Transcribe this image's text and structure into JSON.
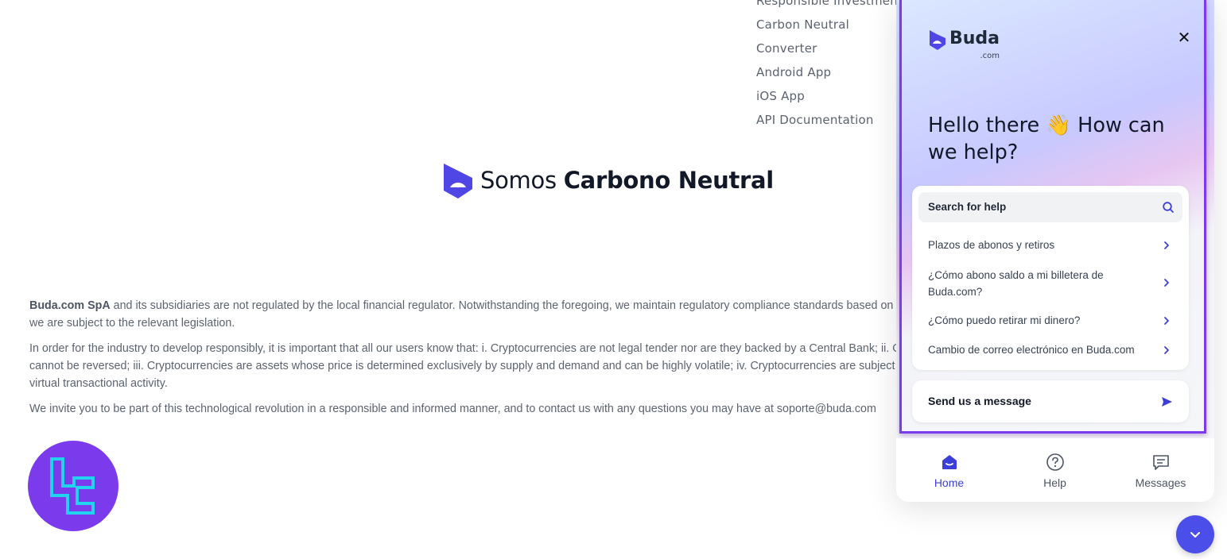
{
  "footer": {
    "links": [
      "Responsible Investment",
      "Carbon Neutral",
      "Converter",
      "Android App",
      "iOS App",
      "API Documentation"
    ]
  },
  "carbon_badge": {
    "prefix": "Somos",
    "bold": "Carbono Neutral"
  },
  "disclaimer": {
    "p1_bold": "Buda.com SpA",
    "p1_line1": " and its subsidiaries are not regulated by the local financial regulator. Notwithstanding the foregoing, we maintain regulatory compliance standards based on the regu",
    "p1_line2": "we are subject to the relevant legislation.",
    "p2_line1": "In order for the industry to develop responsibly, it is important that all our users know that: i. Cryptocurrencies are not legal tender nor are they backed by a Central Bank; ii. Once s",
    "p2_line2": "cannot be reversed; iii. Cryptocurrencies are assets whose price is determined exclusively by supply and demand and can be highly volatile; iv. Cryptocurrencies are subject to the t",
    "p2_line3": "virtual transactional activity.",
    "p3": "We invite you to be part of this technological revolution in a responsible and informed manner, and to contact us with any questions you may have at soporte@buda.com"
  },
  "widget": {
    "brand": "Buda",
    "brand_suffix": ".com",
    "greeting": "Hello there 👋 How can we help?",
    "search_placeholder": "Search for help",
    "faq": [
      "Plazos de abonos y retiros",
      "¿Cómo abono saldo a mi billetera de Buda.com?",
      "¿Cómo puedo retirar mi dinero?",
      "Cambio de correo electrónico en Buda.com"
    ],
    "send_message": "Send us a message",
    "tabs": [
      {
        "label": "Home",
        "icon": "home-icon",
        "active": true
      },
      {
        "label": "Help",
        "icon": "help-icon",
        "active": false
      },
      {
        "label": "Messages",
        "icon": "messages-icon",
        "active": false
      }
    ]
  },
  "colors": {
    "accent": "#3b3fd8",
    "frame": "#7c3aed",
    "fab": "#4b4ee8",
    "watermark": "#7c3aed"
  }
}
